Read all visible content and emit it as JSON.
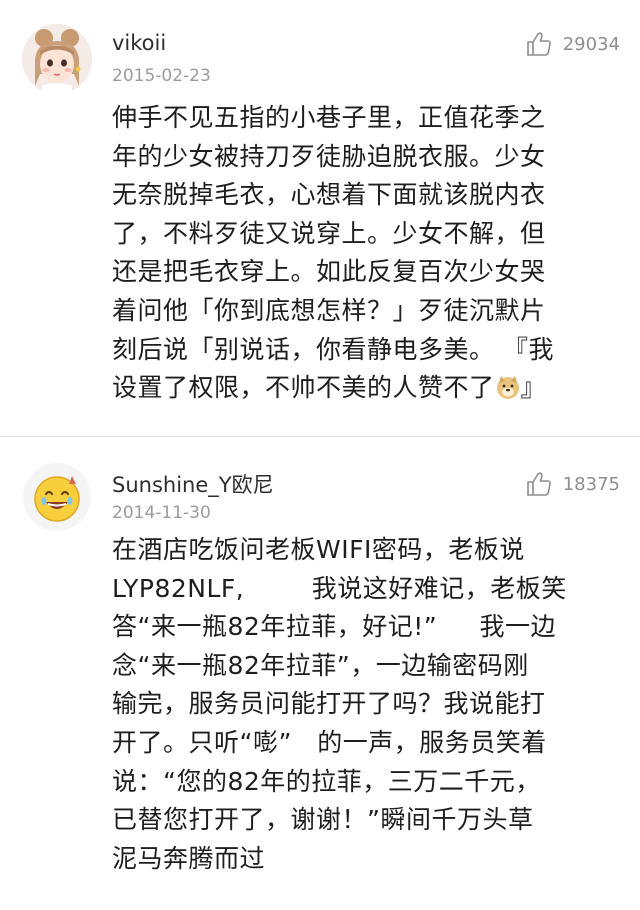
{
  "comments": [
    {
      "username": "vikoii",
      "date": "2015-02-23",
      "likes": "29034",
      "avatar_icon": "girl-avatar",
      "lines": [
        "伸手不见五指的小巷子里，正值花季之",
        "年的少女被持刀歹徒胁迫脱衣服。少女",
        "无奈脱掉毛衣，心想着下面就该脱内衣",
        "了，不料歹徒又说穿上。少女不解，但",
        "还是把毛衣穿上。如此反复百次少女哭",
        "着问他「你到底想怎样？」歹徒沉默片",
        "刻后说「别说话，你看静电多美。 『我",
        "设置了权限，不帅不美的人赞不了",
        "』"
      ],
      "emoji": "doge-emoji"
    },
    {
      "username": "Sunshine_Y欧尼",
      "date": "2014-11-30",
      "likes": "18375",
      "avatar_icon": "laughing-emoji-avatar",
      "lines": [
        "在酒店吃饭问老板WIFI密码，老板说",
        "LYP82NLF,        我说这好难记，老板笑",
        "答“来一瓶82年拉菲，好记!”     我一边",
        "念“来一瓶82年拉菲”，一边输密码刚",
        "输完，服务员问能打开了吗？我说能打",
        "开了。只听“嘭”   的一声，服务员笑着",
        "说：“您的82年的拉菲，三万二千元，",
        "已替您打开了，谢谢！”瞬间千万头草",
        "泥马奔腾而过"
      ]
    }
  ],
  "colors": {
    "name": "#2e2e2e",
    "meta": "#9b9b9b",
    "text": "#1e1e1e",
    "divider": "#e3e3e3"
  }
}
